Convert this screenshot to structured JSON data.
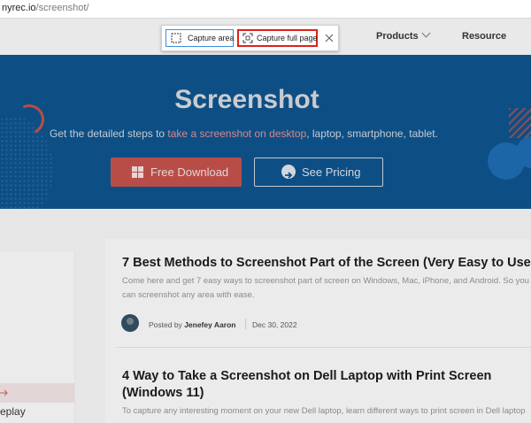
{
  "url": {
    "host": "nyrec.io",
    "path": "/screenshot/"
  },
  "navbar": {
    "products": "Products",
    "resource": "Resource"
  },
  "capture_toolbar": {
    "capture_area": "Capture area",
    "capture_full_page": "Capture full page"
  },
  "hero": {
    "title": "Screenshot",
    "subtitle_before": "Get the detailed steps to ",
    "subtitle_link": "take a screenshot on desktop",
    "subtitle_after": ", laptop, smartphone, tablet.",
    "download_label": "Free Download",
    "pricing_label": "See Pricing"
  },
  "sidebar": {
    "partial_label": "eplay"
  },
  "articles": [
    {
      "title": "7 Best Methods to Screenshot Part of the Screen (Very Easy to Use",
      "excerpt": "Come here and get 7 easy ways to screenshot part of screen on Windows, Mac, iPhone, and Android. So you can screenshot any area with ease.",
      "posted_by": "Posted by",
      "author": "Jenefey Aaron",
      "date": "Dec 30, 2022"
    },
    {
      "title": "4 Way to Take a Screenshot on Dell Laptop with Print Screen (Windows 11)",
      "excerpt": "To capture any interesting moment on your new Dell laptop, learn different ways to print screen in Dell laptop"
    }
  ],
  "colors": {
    "hero_bg": "#0d4f85",
    "download_btn": "#b84d48",
    "capture_full_border": "#e0201b",
    "capture_area_border": "#3b8fd8"
  }
}
